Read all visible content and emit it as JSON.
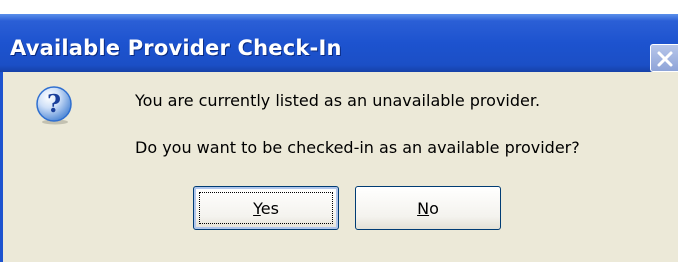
{
  "dialog": {
    "title": "Available Provider Check-In",
    "close_icon": "close-icon",
    "icon": "question-icon",
    "message_line1": "You are currently listed as an unavailable provider.",
    "message_line2": "Do you want to be checked-in as an available provider?",
    "buttons": {
      "yes": {
        "mnemonic": "Y",
        "rest": "es"
      },
      "no": {
        "mnemonic": "N",
        "rest": "o"
      }
    },
    "colors": {
      "titlebar": "#1d53cf",
      "dialog_background": "#ece9d8",
      "icon_blue": "#2f6fd0"
    }
  }
}
